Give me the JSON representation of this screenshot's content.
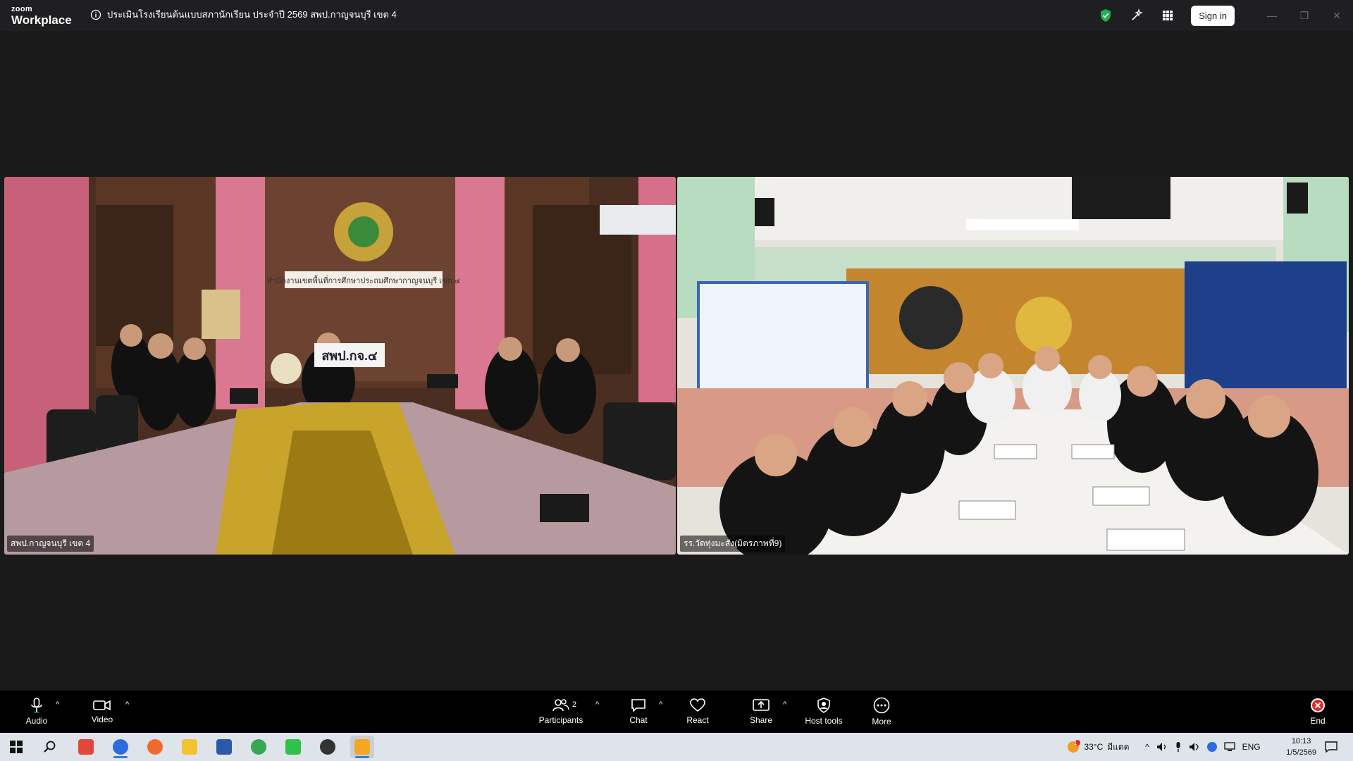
{
  "app": {
    "logo_small": "zoom",
    "logo_big": "Workplace",
    "meeting_title": "ประเมินโรงเรียนต้นแบบสภานักเรียน ประจำปี 2569 สพป.กาญจนบุรี เขต 4",
    "sign_in": "Sign in"
  },
  "window_controls": {
    "minimize": "—",
    "restore": "❐",
    "close": "✕"
  },
  "participants_tiles": [
    {
      "name": "สพป.กาญจนบุรี เขต 4",
      "sign_text": "สำนักงานเขตพื้นที่การศึกษาประถมศึกษากาญจนบุรี เขต ๔",
      "desk_sign": "สพป.กจ.๔"
    },
    {
      "name": "รร.วัดทุ่งมะสัง(มิตรภาพที่9)"
    }
  ],
  "toolbar": {
    "audio": "Audio",
    "video": "Video",
    "participants": "Participants",
    "participants_count": "2",
    "chat": "Chat",
    "react": "React",
    "share": "Share",
    "host_tools": "Host tools",
    "more": "More",
    "end": "End"
  },
  "taskbar": {
    "weather_temp": "33°C",
    "weather_text": "มีแดด",
    "language": "ENG",
    "time": "10:13",
    "date": "1/5/2569",
    "weather_badge": "1"
  },
  "colors": {
    "accent_green": "#1fb153",
    "end_red": "#e02828",
    "active_blue": "#3a7bd5"
  }
}
